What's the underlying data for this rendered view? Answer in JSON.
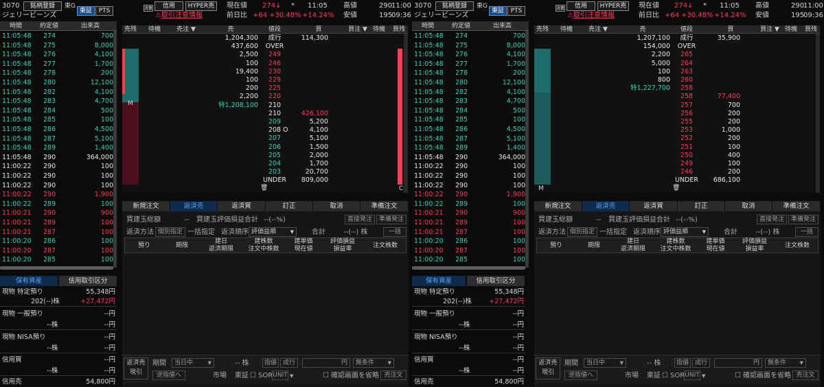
{
  "common": {
    "code": "3070",
    "market_badge": "東G",
    "name": "ジェリービーンズ",
    "btn_register": "銘柄登録",
    "btn_tosho": "東証",
    "btn_pts": "PTS",
    "btn_credit": "信用",
    "btn_hyper": "HYPER売",
    "kessai_icon": "決算",
    "warn_text": "取引注意情報",
    "lbl_current": "現在値",
    "current_price": "274",
    "current_arrow": "↓",
    "star": "*",
    "current_time": "11:05",
    "lbl_prev": "前日比",
    "prev_change": "+64",
    "prev_pct": "+30.48%",
    "prev_pct2": "+14.24%",
    "lbl_high": "高値",
    "high": "290",
    "high_time": "11:00",
    "lbl_low": "安値",
    "low": "195",
    "low_time": "09:36",
    "ta_headers": [
      "時間",
      "約定値",
      "出来高"
    ],
    "hold_tabs": [
      "保有資産",
      "信用取引区分"
    ],
    "hold": {
      "r1_label": "現物 特定預り",
      "r1_val": "55,348円",
      "r2_label": "202(--)株",
      "r2_val": "+27,472円",
      "r3_label": "現物 一般預り",
      "r3_val": "--円",
      "r4_label": "--株",
      "r4_val": "--円",
      "r5_label": "現物 NISA預り",
      "r5_val": "--円",
      "r6_label": "--株",
      "r6_val": "--円",
      "r7_label": "信用買",
      "r7_val": "--円",
      "r8_label": "--株",
      "r8_val": "--円",
      "r9_label": "信用売",
      "r9_val": "54,800円"
    },
    "ob_headers": [
      "売残",
      "待機",
      "売注 ▼",
      "売",
      "値段",
      "買",
      "買注 ▼",
      "待機",
      "買残"
    ],
    "trash_icon": "🗑",
    "order_tabs": [
      "新規注文",
      "返済売",
      "返済買",
      "訂正",
      "取消",
      "準備注文"
    ],
    "order": {
      "total_label": "買建玉総額",
      "total_dash": "--",
      "pl_label": "買建玉評価損益合計",
      "pl_val": "--(--%)",
      "btn_direct": "直接発注",
      "btn_prep": "準備発注",
      "method_label": "返済方法",
      "method_indiv": "個別指定",
      "method_bulk": "一括指定",
      "order_label": "返済順序",
      "order_sel": "評価益順",
      "sum_label": "合計",
      "sum_val": "--(--) 株",
      "btn_bulk": "一括",
      "cols": [
        "預り",
        "期限",
        "建日\n返済期限",
        "建株数\n注文中株数",
        "建単価\n現在値",
        "評価損益\n損益率",
        "注文株数"
      ],
      "foot_side": "返済売",
      "foot_side2": "現引",
      "foot_period": "期間",
      "foot_period_val": "当日中",
      "foot_qty": "-- 株",
      "foot_limit": "指値",
      "foot_market": "成行",
      "foot_yen": "円",
      "foot_cond": "無条件",
      "foot_reverse": "逆指値へ",
      "foot_mkt_label": "市場",
      "foot_mkt_val": "東証",
      "foot_sor": "SOR",
      "foot_unit": "UNIT",
      "foot_confirm": "確認画面を省略",
      "foot_submit": "売注文"
    }
  },
  "trades": [
    [
      "11:05:48",
      "274",
      "700",
      "g"
    ],
    [
      "11:05:48",
      "275",
      "8,000",
      "g"
    ],
    [
      "11:05:48",
      "276",
      "4,100",
      "g"
    ],
    [
      "11:05:48",
      "277",
      "1,700",
      "g"
    ],
    [
      "11:05:48",
      "278",
      "200",
      "g"
    ],
    [
      "11:05:48",
      "280",
      "12,100",
      "g"
    ],
    [
      "11:05:48",
      "282",
      "4,100",
      "g"
    ],
    [
      "11:05:48",
      "283",
      "4,700",
      "g"
    ],
    [
      "11:05:48",
      "284",
      "500",
      "g"
    ],
    [
      "11:05:48",
      "285",
      "100",
      "g"
    ],
    [
      "11:05:48",
      "286",
      "4,500",
      "g"
    ],
    [
      "11:05:48",
      "287",
      "5,100",
      "g"
    ],
    [
      "11:05:48",
      "289",
      "1,400",
      "g"
    ],
    [
      "11:05:48",
      "290",
      "364,000",
      "w"
    ],
    [
      "11:00:22",
      "290",
      "100",
      "w"
    ],
    [
      "11:00:22",
      "290",
      "100",
      "w"
    ],
    [
      "11:00:22",
      "290",
      "100",
      "w"
    ],
    [
      "11:00:22",
      "290",
      "1,900",
      "r"
    ],
    [
      "11:00:22",
      "289",
      "100",
      "g"
    ],
    [
      "11:00:21",
      "290",
      "900",
      "r"
    ],
    [
      "11:00:21",
      "289",
      "100",
      "r"
    ],
    [
      "11:00:21",
      "287",
      "100",
      "r"
    ],
    [
      "11:00:20",
      "286",
      "100",
      "g"
    ],
    [
      "11:00:20",
      "287",
      "100",
      "r"
    ],
    [
      "11:00:20",
      "285",
      "100",
      "g"
    ]
  ],
  "book1": [
    {
      "sell": "1,204,300",
      "price": "成行",
      "buy": "114,300",
      "pc": "w"
    },
    {
      "sell": "437,600",
      "price": "OVER",
      "buy": "",
      "pc": "w"
    },
    {
      "sell": "2,500",
      "price": "249",
      "buy": "",
      "pc": "r"
    },
    {
      "sell": "100",
      "price": "246",
      "buy": "",
      "pc": "r"
    },
    {
      "sell": "19,400",
      "price": "230",
      "buy": "",
      "pc": "r"
    },
    {
      "sell": "100",
      "price": "229",
      "buy": "",
      "pc": "r"
    },
    {
      "sell": "200",
      "price": "225",
      "buy": "",
      "pc": "r"
    },
    {
      "sell": "2,200",
      "price": "220",
      "buy": "",
      "pc": "r"
    },
    {
      "sell": "特1,208,100",
      "price": "210",
      "buy": "",
      "pc": "w",
      "sg": true,
      "m": "M"
    },
    {
      "sell": "",
      "price": "210",
      "buy": "426,100",
      "pc": "w",
      "br": true
    },
    {
      "sell": "",
      "price": "209",
      "buy": "5,200",
      "pc": "g"
    },
    {
      "sell": "",
      "price": "208",
      "buy": "4,100",
      "pc": "w",
      "o": "O"
    },
    {
      "sell": "",
      "price": "207",
      "buy": "5,100",
      "pc": "g"
    },
    {
      "sell": "",
      "price": "206",
      "buy": "1,500",
      "pc": "g"
    },
    {
      "sell": "",
      "price": "205",
      "buy": "2,000",
      "pc": "g"
    },
    {
      "sell": "",
      "price": "204",
      "buy": "1,700",
      "pc": "g"
    },
    {
      "sell": "",
      "price": "203",
      "buy": "20,700",
      "pc": "g"
    },
    {
      "sell": "",
      "price": "UNDER",
      "buy": "809,000",
      "pc": "w"
    }
  ],
  "book2": [
    {
      "sell": "1,207,100",
      "price": "成行",
      "buy": "35,900",
      "pc": "w"
    },
    {
      "sell": "154,000",
      "price": "OVER",
      "buy": "",
      "pc": "w"
    },
    {
      "sell": "2,200",
      "price": "265",
      "buy": "",
      "pc": "r"
    },
    {
      "sell": "5,000",
      "price": "264",
      "buy": "",
      "pc": "r"
    },
    {
      "sell": "100",
      "price": "263",
      "buy": "",
      "pc": "r"
    },
    {
      "sell": "800",
      "price": "260",
      "buy": "",
      "pc": "r"
    },
    {
      "sell": "特1,227,700",
      "price": "258",
      "buy": "",
      "pc": "r",
      "sg": true
    },
    {
      "sell": "",
      "price": "258",
      "buy": "77,400",
      "pc": "r",
      "br": true
    },
    {
      "sell": "",
      "price": "257",
      "buy": "700",
      "pc": "r"
    },
    {
      "sell": "",
      "price": "256",
      "buy": "200",
      "pc": "r"
    },
    {
      "sell": "",
      "price": "255",
      "buy": "200",
      "pc": "r"
    },
    {
      "sell": "",
      "price": "253",
      "buy": "1,000",
      "pc": "r"
    },
    {
      "sell": "",
      "price": "252",
      "buy": "200",
      "pc": "r"
    },
    {
      "sell": "",
      "price": "251",
      "buy": "100",
      "pc": "r"
    },
    {
      "sell": "",
      "price": "250",
      "buy": "400",
      "pc": "r"
    },
    {
      "sell": "",
      "price": "249",
      "buy": "100",
      "pc": "r"
    },
    {
      "sell": "",
      "price": "246",
      "buy": "200",
      "pc": "r"
    },
    {
      "sell": "",
      "price": "UNDER",
      "buy": "686,100",
      "pc": "w"
    }
  ],
  "panel2": {
    "m_label": "M",
    "c_label": "C"
  },
  "panel1": {
    "c_label": "C"
  },
  "colors": {
    "up": "#ff3d55",
    "down": "#35d3bb",
    "accent": "#4fa8ff"
  }
}
